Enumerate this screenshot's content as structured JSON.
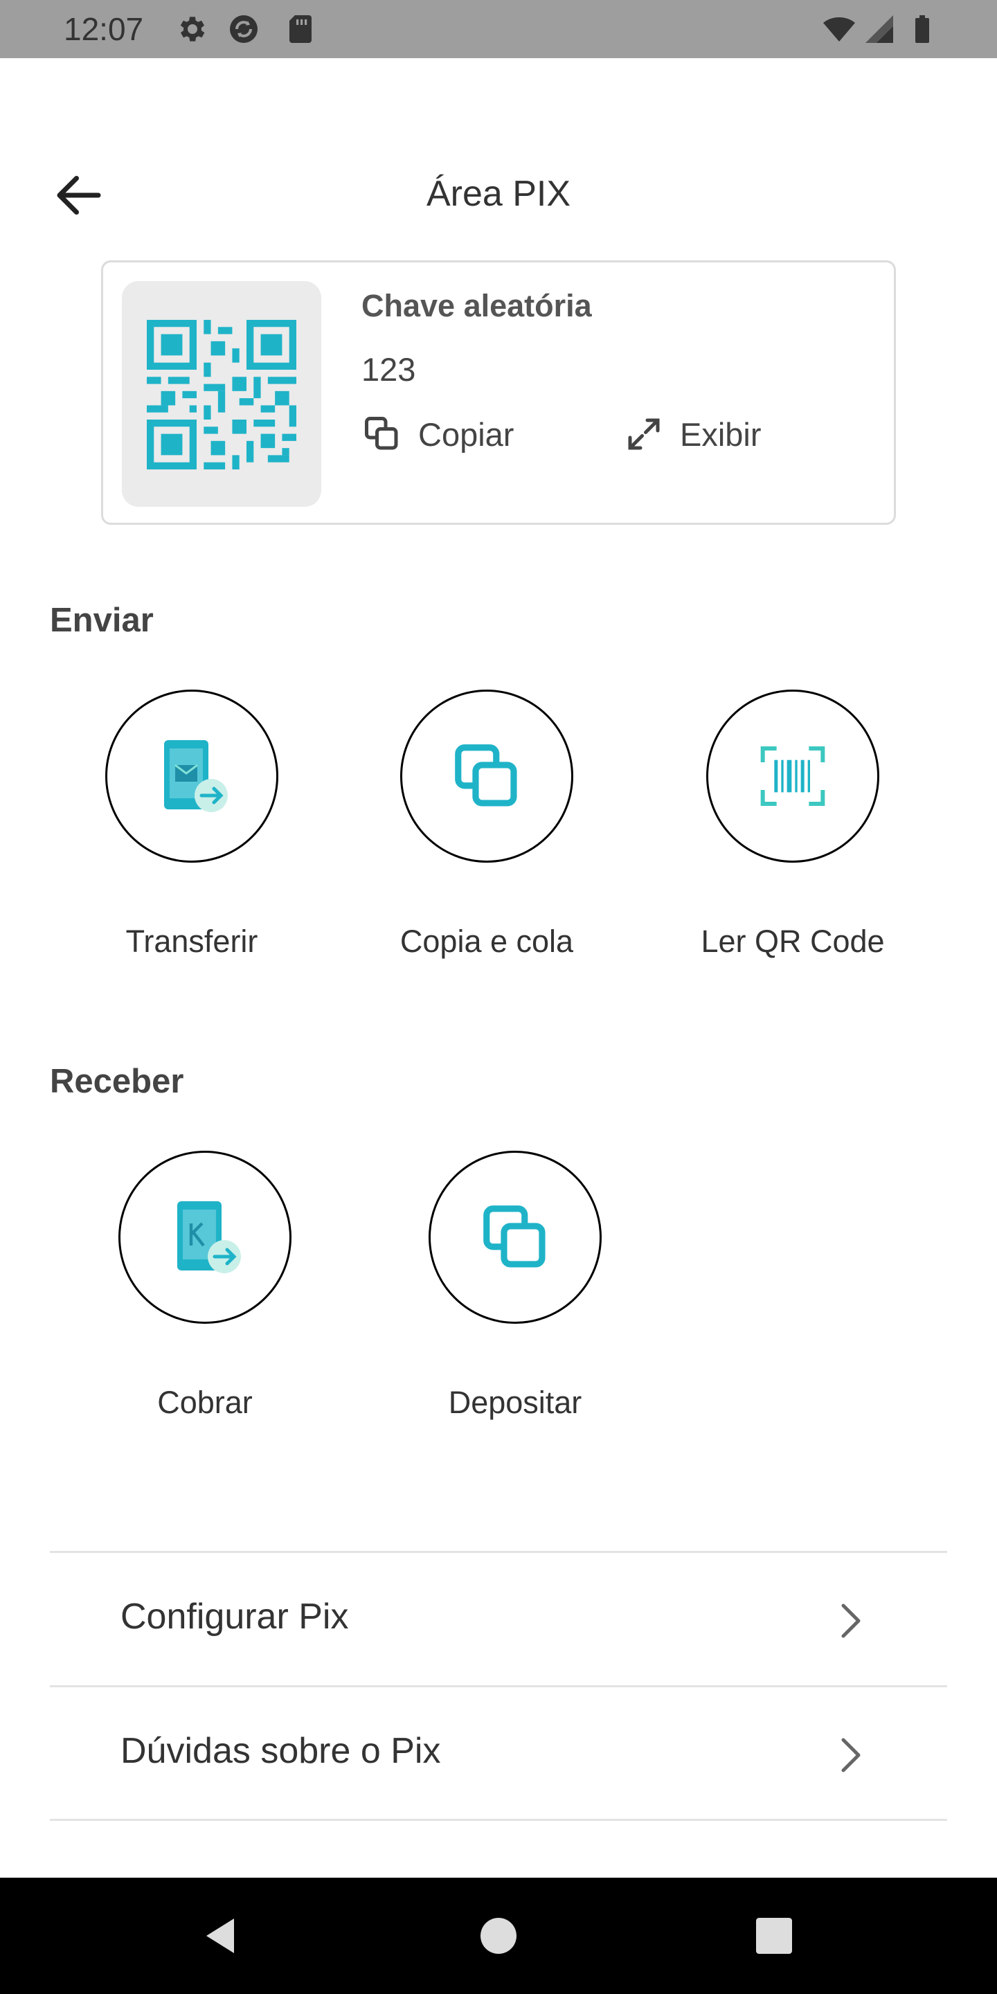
{
  "status_bar": {
    "time": "12:07",
    "left_icons": [
      "gear-icon",
      "sync-icon",
      "sd-card-icon"
    ],
    "right_icons": [
      "wifi-icon",
      "signal-icon",
      "battery-icon"
    ]
  },
  "header": {
    "back_icon": "arrow-left-icon",
    "title": "Área PIX"
  },
  "key_card": {
    "qr_icon": "qr-code-icon",
    "key_type": "Chave aleatória",
    "key_value": "123",
    "copy_label": "Copiar",
    "show_label": "Exibir"
  },
  "send": {
    "title": "Enviar",
    "actions": [
      {
        "label": "Transferir",
        "icon": "phone-transfer-icon"
      },
      {
        "label": "Copia e cola",
        "icon": "copy-icon"
      },
      {
        "label": "Ler QR Code",
        "icon": "barcode-scan-icon"
      }
    ]
  },
  "receive": {
    "title": "Receber",
    "actions": [
      {
        "label": "Cobrar",
        "icon": "phone-charge-icon"
      },
      {
        "label": "Depositar",
        "icon": "copy-icon"
      }
    ]
  },
  "menu": {
    "items": [
      {
        "label": "Configurar Pix",
        "icon": "chevron-right-icon"
      },
      {
        "label": "Dúvidas sobre o Pix",
        "icon": "chevron-right-icon"
      }
    ]
  },
  "nav_bar": {
    "icons": [
      "back-triangle-icon",
      "home-circle-icon",
      "recents-square-icon"
    ]
  },
  "colors": {
    "accent": "#1fb3c8",
    "accent_light": "#7fdad3",
    "status_bar": "#9e9e9e",
    "text": "#333333",
    "divider": "#e3e3e3"
  }
}
